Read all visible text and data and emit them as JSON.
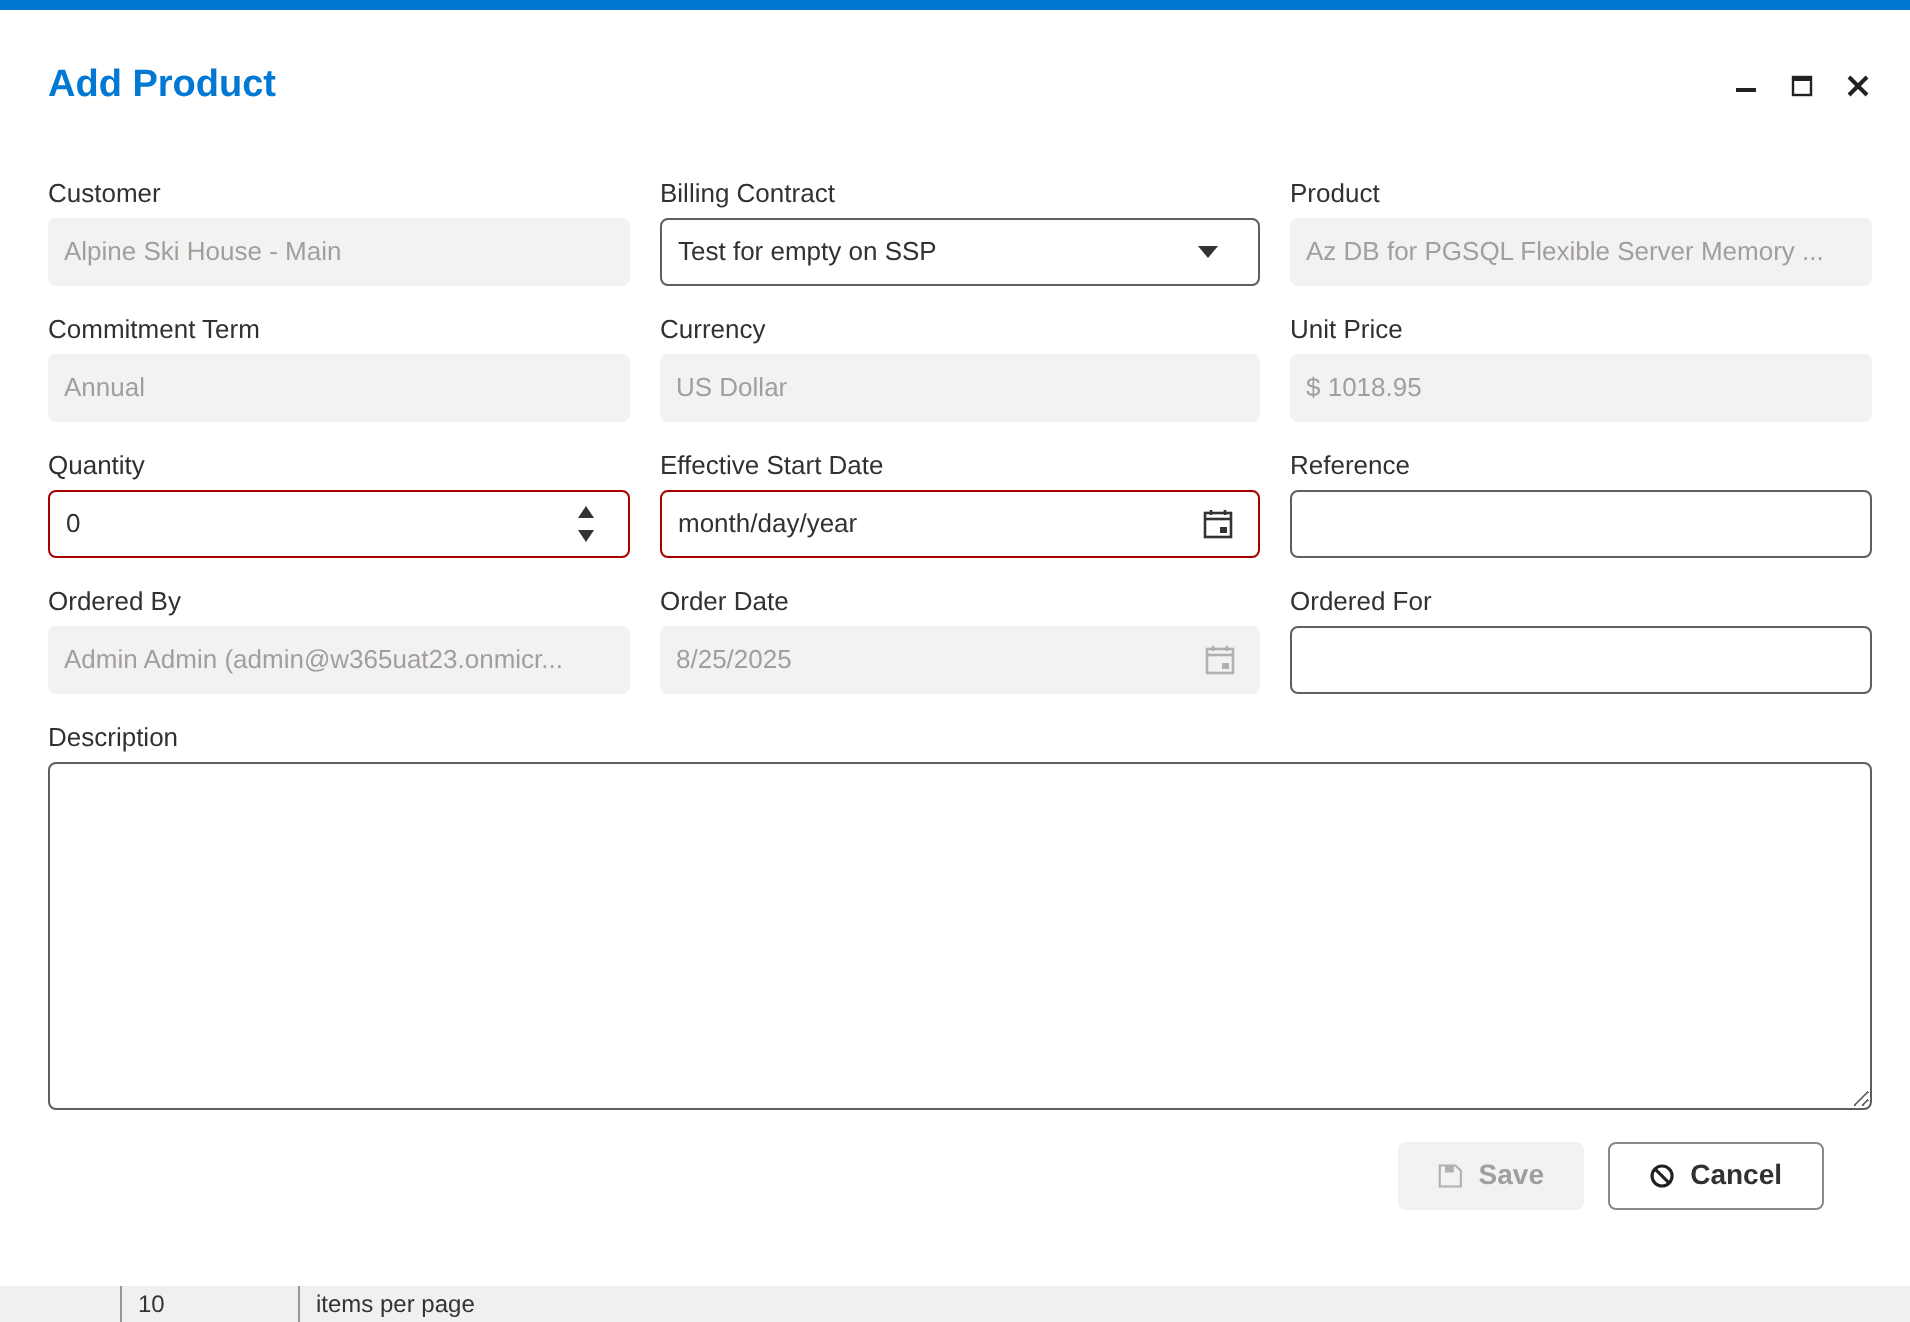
{
  "dialog": {
    "title": "Add Product"
  },
  "fields": [
    {
      "label": "Customer",
      "kind": "text",
      "value": "Alpine Ski House - Main",
      "disabled": true
    },
    {
      "label": "Billing Contract",
      "kind": "select",
      "value": "Test for empty on SSP",
      "disabled": false,
      "invalid": false
    },
    {
      "label": "Product",
      "kind": "text",
      "value": "Az DB for PGSQL Flexible Server Memory ...",
      "disabled": true
    },
    {
      "label": "Commitment Term",
      "kind": "text",
      "value": "Annual",
      "disabled": true
    },
    {
      "label": "Currency",
      "kind": "text",
      "value": "US Dollar",
      "disabled": true
    },
    {
      "label": "Unit Price",
      "kind": "text",
      "value": "$ 1018.95",
      "disabled": true
    },
    {
      "label": "Quantity",
      "kind": "number",
      "value": "0",
      "disabled": false,
      "invalid": true
    },
    {
      "label": "Effective Start Date",
      "kind": "date",
      "value": "month/day/year",
      "disabled": false,
      "invalid": true
    },
    {
      "label": "Reference",
      "kind": "text",
      "disabled": false,
      "invalid": false
    },
    {
      "label": "Ordered By",
      "kind": "text",
      "value": "Admin Admin (admin@w365uat23.onmicr...",
      "disabled": true
    },
    {
      "label": "Order Date",
      "kind": "date",
      "value": "8/25/2025",
      "disabled": true
    },
    {
      "label": "Ordered For",
      "kind": "text",
      "disabled": false,
      "invalid": false
    }
  ],
  "description": {
    "label": "Description"
  },
  "buttons": [
    {
      "label": "Save",
      "kind": "save",
      "disabled": true
    },
    {
      "label": "Cancel",
      "kind": "cancel",
      "disabled": false
    }
  ],
  "pager": {
    "page_size": "10",
    "label": "items per page"
  }
}
